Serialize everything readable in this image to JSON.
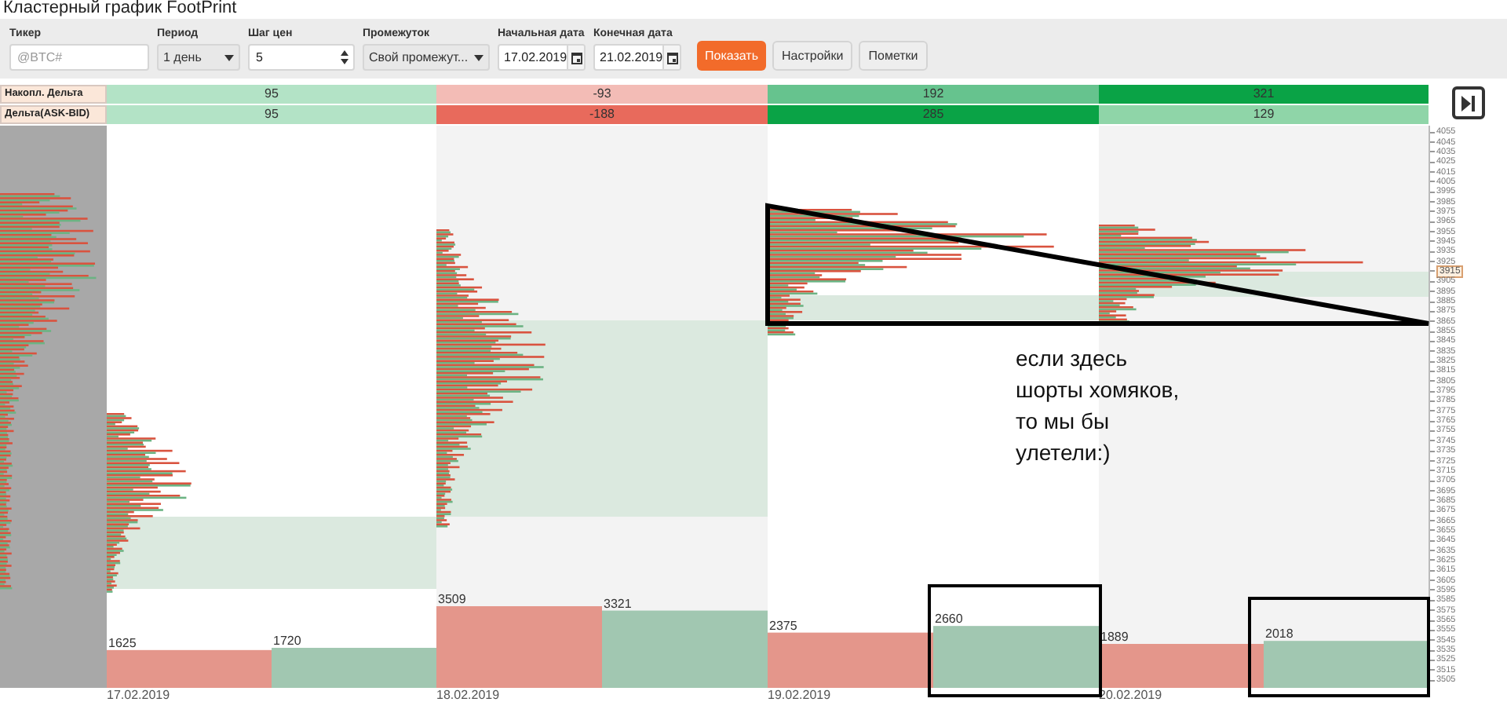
{
  "title": "Кластерный график FootPrint",
  "toolbar": {
    "fields": [
      {
        "kind": "text",
        "label": "Тикер",
        "placeholder": "@BTC#"
      },
      {
        "kind": "select",
        "label": "Период",
        "value": "1 день"
      },
      {
        "kind": "spinner",
        "label": "Шаг цен",
        "value": "5"
      },
      {
        "kind": "select",
        "label": "Промежуток",
        "value": "Свой промежут..."
      },
      {
        "kind": "date",
        "label": "Начальная дата",
        "value": "17.02.2019"
      },
      {
        "kind": "date",
        "label": "Конечная дата",
        "value": "21.02.2019"
      }
    ],
    "buttons": [
      {
        "label": "Показать",
        "primary": true
      },
      {
        "label": "Настройки",
        "primary": false
      },
      {
        "label": "Пометки",
        "primary": false
      }
    ]
  },
  "delta_rows": [
    {
      "label": "Накопл. Дельта",
      "cells": [
        {
          "value": "95",
          "color": "#b3e3c6"
        },
        {
          "value": "-93",
          "color": "#f3bcb6"
        },
        {
          "value": "192",
          "color": "#66c38e"
        },
        {
          "value": "321",
          "color": "#0aa346"
        }
      ]
    },
    {
      "label": "Дельта(ASK-BID)",
      "cells": [
        {
          "value": "95",
          "color": "#b3e3c6"
        },
        {
          "value": "-188",
          "color": "#e86a5c"
        },
        {
          "value": "285",
          "color": "#0aa346"
        },
        {
          "value": "129",
          "color": "#8fd5a8"
        }
      ]
    }
  ],
  "chart": {
    "columns": [
      {
        "date": "17.02.2019",
        "sell": "1625",
        "buy": "1720"
      },
      {
        "date": "18.02.2019",
        "sell": "3509",
        "buy": "3321"
      },
      {
        "date": "19.02.2019",
        "sell": "2375",
        "buy": "2660"
      },
      {
        "date": "20.02.2019",
        "sell": "1889",
        "buy": "2018"
      }
    ],
    "price_axis": [
      {
        "kind": "tick",
        "label": "4055"
      },
      {
        "kind": "tick",
        "label": "4045"
      },
      {
        "kind": "tick",
        "label": "4035"
      },
      {
        "kind": "tick",
        "label": "4025"
      },
      {
        "kind": "tick",
        "label": "4015"
      },
      {
        "kind": "tick",
        "label": "4005"
      },
      {
        "kind": "tick",
        "label": "3995"
      },
      {
        "kind": "tick",
        "label": "3985"
      },
      {
        "kind": "tick",
        "label": "3975"
      },
      {
        "kind": "tick",
        "label": "3965"
      },
      {
        "kind": "tick",
        "label": "3955"
      },
      {
        "kind": "tick",
        "label": "3945"
      },
      {
        "kind": "tick",
        "label": "3935"
      },
      {
        "kind": "tick",
        "label": "3925"
      },
      {
        "kind": "marker",
        "label": "3915"
      },
      {
        "kind": "tick",
        "label": "3905"
      },
      {
        "kind": "tick",
        "label": "3895"
      },
      {
        "kind": "tick",
        "label": "3885"
      },
      {
        "kind": "tick",
        "label": "3875"
      },
      {
        "kind": "tick",
        "label": "3865"
      },
      {
        "kind": "tick",
        "label": "3855"
      },
      {
        "kind": "tick",
        "label": "3845"
      },
      {
        "kind": "tick",
        "label": "3835"
      },
      {
        "kind": "tick",
        "label": "3825"
      },
      {
        "kind": "tick",
        "label": "3815"
      },
      {
        "kind": "tick",
        "label": "3805"
      },
      {
        "kind": "tick",
        "label": "3795"
      },
      {
        "kind": "tick",
        "label": "3785"
      },
      {
        "kind": "tick",
        "label": "3775"
      },
      {
        "kind": "tick",
        "label": "3765"
      },
      {
        "kind": "tick",
        "label": "3755"
      },
      {
        "kind": "tick",
        "label": "3745"
      },
      {
        "kind": "tick",
        "label": "3735"
      },
      {
        "kind": "tick",
        "label": "3725"
      },
      {
        "kind": "tick",
        "label": "3715"
      },
      {
        "kind": "tick",
        "label": "3705"
      },
      {
        "kind": "tick",
        "label": "3695"
      },
      {
        "kind": "tick",
        "label": "3685"
      },
      {
        "kind": "tick",
        "label": "3675"
      },
      {
        "kind": "tick",
        "label": "3665"
      },
      {
        "kind": "tick",
        "label": "3655"
      },
      {
        "kind": "tick",
        "label": "3645"
      },
      {
        "kind": "tick",
        "label": "3635"
      },
      {
        "kind": "tick",
        "label": "3625"
      },
      {
        "kind": "tick",
        "label": "3615"
      },
      {
        "kind": "tick",
        "label": "3605"
      },
      {
        "kind": "tick",
        "label": "3595"
      },
      {
        "kind": "tick",
        "label": "3585"
      },
      {
        "kind": "tick",
        "label": "3575"
      },
      {
        "kind": "tick",
        "label": "3565"
      },
      {
        "kind": "tick",
        "label": "3555"
      },
      {
        "kind": "tick",
        "label": "3545"
      },
      {
        "kind": "tick",
        "label": "3535"
      },
      {
        "kind": "tick",
        "label": "3525"
      },
      {
        "kind": "tick",
        "label": "3515"
      },
      {
        "kind": "tick",
        "label": "3505"
      }
    ]
  },
  "annotation": {
    "text": "если здесь\nшорты хомяков,\nто мы бы\nулетели:)"
  }
}
